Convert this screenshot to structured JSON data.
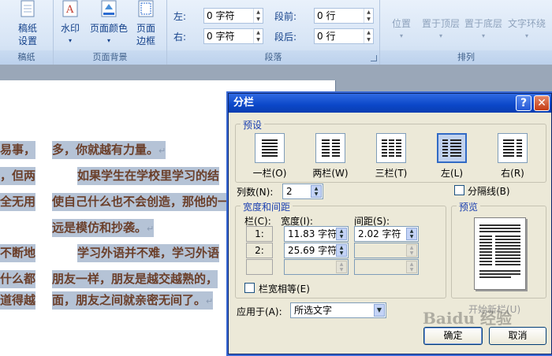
{
  "ribbon": {
    "groups": {
      "draft": {
        "label": "稿纸",
        "button_line1": "稿纸",
        "button_line2": "设置"
      },
      "page_background": {
        "label": "页面背景",
        "watermark": "水印",
        "page_color": "页面颜色",
        "borders_line1": "页面",
        "borders_line2": "边框"
      },
      "paragraph": {
        "label": "段落",
        "indent_left_label": "左:",
        "indent_left_value": "0 字符",
        "indent_right_label": "右:",
        "indent_right_value": "0 字符",
        "space_before_label": "段前:",
        "space_before_value": "0 行",
        "space_after_label": "段后:",
        "space_after_value": "0 行"
      },
      "arrange": {
        "label": "排列",
        "position": "位置",
        "bring_front": "置于顶层",
        "send_back": "置于底层",
        "text_wrap": "文字环绕"
      }
    }
  },
  "document": {
    "lines": [
      {
        "left": "易事，",
        "right": "多，你就越有力量。"
      },
      {
        "left": "，但两",
        "right": "如果学生在学校里学习的结"
      },
      {
        "left": "全无用",
        "right": "使自己什么也不会创造，那他的一"
      },
      {
        "left": "",
        "right": "远是模仿和抄袭。"
      },
      {
        "left": "不断地",
        "right": "学习外语并不难，学习外语"
      },
      {
        "left": "什么都",
        "right": "朋友一样，朋友是越交越熟的，"
      },
      {
        "left": "道得越",
        "right": "面，朋友之间就亲密无间了。"
      }
    ],
    "para_mark": "↵"
  },
  "dialog": {
    "title": "分栏",
    "help_button": "?",
    "close_button": "✕",
    "presets_legend": "预设",
    "presets": [
      {
        "label": "一栏(O)",
        "active": false
      },
      {
        "label": "两栏(W)",
        "active": false
      },
      {
        "label": "三栏(T)",
        "active": false
      },
      {
        "label": "左(L)",
        "active": true
      },
      {
        "label": "右(R)",
        "active": false
      }
    ],
    "num_columns_label": "列数(N):",
    "num_columns_value": "2",
    "separator_label": "分隔线(B)",
    "width_spacing_legend": "宽度和间距",
    "col_header": "栏(C):",
    "width_header": "宽度(I):",
    "spacing_header": "间距(S):",
    "rows": [
      {
        "num": "1:",
        "width": "11.83 字符",
        "spacing": "2.02 字符"
      },
      {
        "num": "2:",
        "width": "25.69 字符",
        "spacing": ""
      }
    ],
    "equal_width_label": "栏宽相等(E)",
    "preview_legend": "预览",
    "apply_to_label": "应用于(A):",
    "apply_to_value": "所选文字",
    "new_column_label": "开始新栏(U)",
    "ok_button": "确定",
    "cancel_button": "取消"
  },
  "watermark_text": "Baidu 经验"
}
